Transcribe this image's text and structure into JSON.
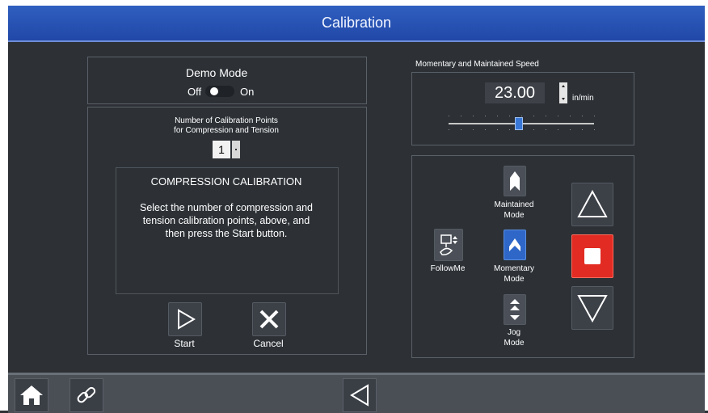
{
  "window": {
    "title": "Calibration"
  },
  "demo": {
    "label": "Demo Mode",
    "off_label": "Off",
    "on_label": "On",
    "state": "off"
  },
  "calibration_points": {
    "label_line1": "Number of Calibration Points",
    "label_line2": "for Compression and Tension",
    "value": "1"
  },
  "instructions": {
    "title": "COMPRESSION CALIBRATION",
    "line1": "Select the number of compression and",
    "line2": "tension calibration points, above, and",
    "line3": "then press the Start button."
  },
  "actions": {
    "start_label": "Start",
    "cancel_label": "Cancel"
  },
  "speed": {
    "label": "Momentary and Maintained Speed",
    "value": "23.00",
    "unit": "in/min",
    "slider_fraction": 0.48
  },
  "modes": {
    "maintained_line1": "Maintained",
    "maintained_line2": "Mode",
    "momentary_line1": "Momentary",
    "momentary_line2": "Mode",
    "jog_line1": "Jog",
    "jog_line2": "Mode",
    "followme_label": "FollowMe",
    "active": "momentary"
  },
  "icons": {
    "home": "home-icon",
    "link": "link-icon",
    "back": "back-arrow-icon",
    "start": "play-outline-icon",
    "cancel": "x-icon",
    "up": "triangle-up-icon",
    "stop": "stop-icon",
    "down": "triangle-down-icon",
    "followme": "followme-icon",
    "maintained": "single-chevron-icon",
    "momentary": "chevron-icon",
    "jog": "double-chevron-icon"
  },
  "colors": {
    "title_bar": "#2148a8",
    "background": "#2d3136",
    "active_mode": "#2e67c7",
    "stop": "#e22b22"
  }
}
